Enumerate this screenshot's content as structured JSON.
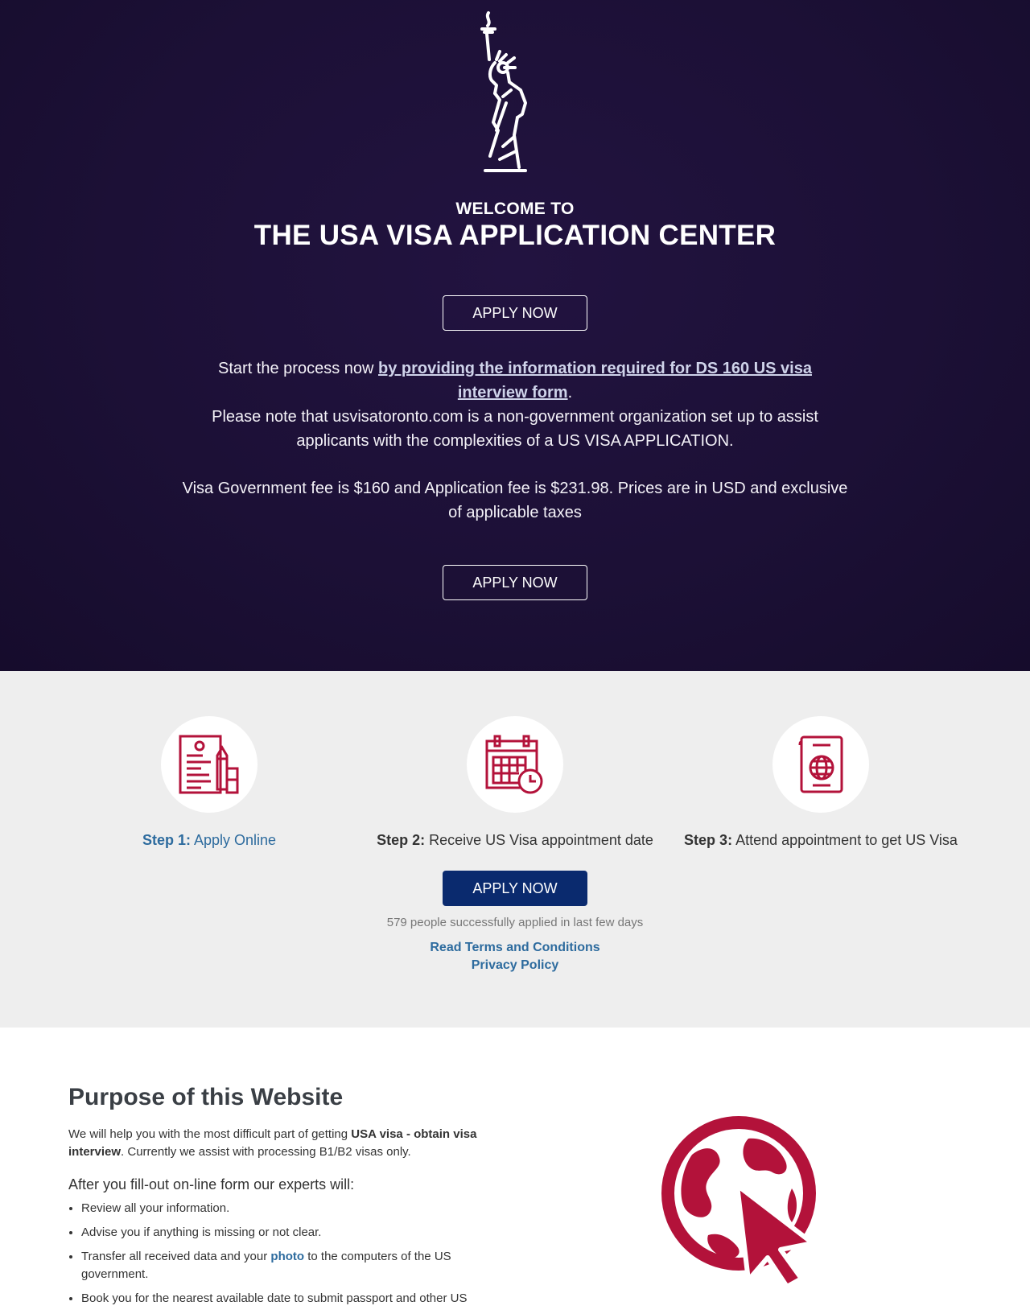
{
  "hero": {
    "welcome_small": "WELCOME TO",
    "welcome_title": "THE USA VISA APPLICATION CENTER",
    "apply_label": "APPLY NOW",
    "start_prefix": "Start the process now ",
    "start_link": "by providing the information required for DS 160 US visa interview form",
    "start_suffix": ".",
    "note": "Please note that usvisatoronto.com is a non-government organization set up to assist applicants with the complexities of a US VISA APPLICATION.",
    "fee": "Visa Government fee is $160 and Application fee is $231.98. Prices are in USD and exclusive of applicable taxes"
  },
  "steps": {
    "step1_prefix": "Step 1:",
    "step1_text": "Apply Online",
    "step2_prefix": "Step 2:",
    "step2_text": "Receive US Visa appointment date",
    "step3_prefix": "Step 3:",
    "step3_text": "Attend appointment to get US Visa",
    "apply_label": "APPLY NOW",
    "applied_count": "579 people successfully applied in last few days",
    "terms_link": "Read Terms and Conditions",
    "privacy_link": "Privacy Policy"
  },
  "purpose": {
    "title": "Purpose of this Website",
    "intro_prefix": "We will help you with the most difficult part of getting ",
    "intro_bold": "USA visa - obtain visa interview",
    "intro_suffix": ". Currently we assist with processing B1/B2 visas only.",
    "after_heading": "After you fill-out on-line form our experts will:",
    "items": [
      "Review all your information.",
      "Advise you if anything is missing or not clear."
    ],
    "item3_prefix": "Transfer all received data and your ",
    "item3_link": "photo",
    "item3_suffix": " to the computers of the US government.",
    "item4": "Book you for the nearest available date to submit passport and other US"
  },
  "colors": {
    "hero_bg": "#1c1036",
    "steps_bg": "#eeeeee",
    "icon_red": "#b3123a",
    "primary_button": "#0a2a6e",
    "link_blue": "#2d6b9e"
  },
  "icons": {
    "hero": "statue-of-liberty-icon",
    "step1": "application-form-icon",
    "step2": "calendar-clock-icon",
    "step3": "passport-icon",
    "purpose": "globe-cursor-icon"
  }
}
